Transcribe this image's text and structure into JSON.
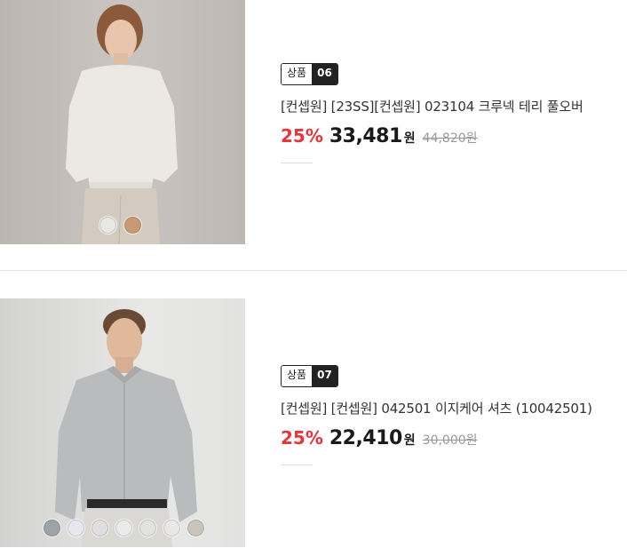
{
  "products": [
    {
      "badge_label": "상품",
      "badge_number": "06",
      "title": "[컨셉원] [23SS][컨셉원] 023104 크루넥 테리 풀오버",
      "discount": "25%",
      "price": "33,481",
      "currency": "원",
      "original_price": "44,820원",
      "swatches": [
        "#e9e7e3",
        "#c79a72"
      ]
    },
    {
      "badge_label": "상품",
      "badge_number": "07",
      "title": "[컨셉원] [컨셉원] 042501 이지케어 셔츠 (10042501)",
      "discount": "25%",
      "price": "22,410",
      "currency": "원",
      "original_price": "30,000원",
      "swatches": [
        "#9ea3a8",
        "#e6e8ee",
        "#dedee0",
        "#eaeaea",
        "#e2e3e1",
        "#e9e8e6",
        "#c9c5bb"
      ]
    }
  ],
  "colors": {
    "discount_red": "#e8353b",
    "badge_dark": "#222222"
  }
}
